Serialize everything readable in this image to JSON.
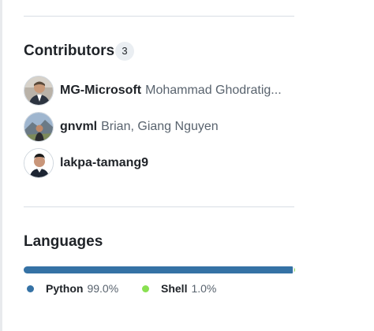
{
  "contributors": {
    "title": "Contributors",
    "count": "3",
    "items": [
      {
        "login": "MG-Microsoft",
        "name": "Mohammad Ghodratig...",
        "avatar": "avatar-photo-suit"
      },
      {
        "login": "gnvml",
        "name": "Brian, Giang Nguyen",
        "avatar": "avatar-photo-mountain"
      },
      {
        "login": "lakpa-tamang9",
        "name": "",
        "avatar": "avatar-photo-portrait"
      }
    ]
  },
  "languages": {
    "title": "Languages",
    "items": [
      {
        "name": "Python",
        "percent_label": "99.0%",
        "fraction": 0.99,
        "color": "#3572a5"
      },
      {
        "name": "Shell",
        "percent_label": "1.0%",
        "fraction": 0.01,
        "color": "#89e051"
      }
    ]
  }
}
